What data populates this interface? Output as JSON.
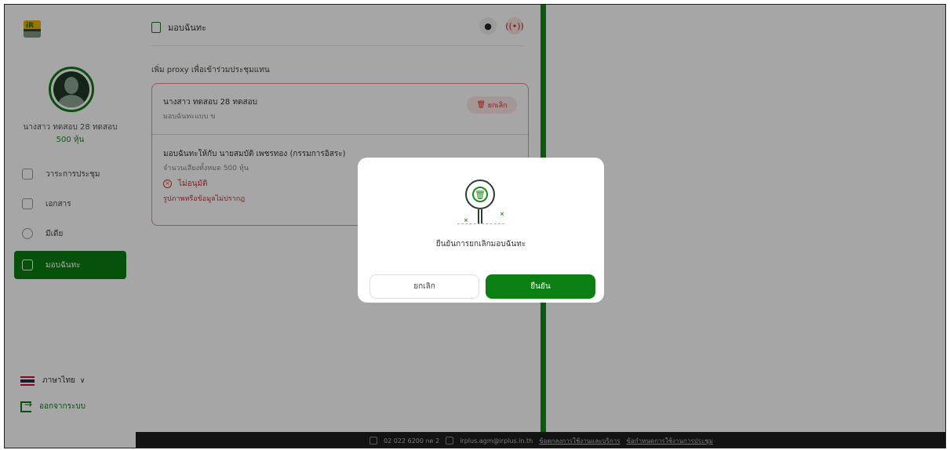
{
  "sidebar": {
    "user_name": "นางสาว ทดสอบ 28 ทดสอบ",
    "user_shares": "500 หุ้น",
    "nav": [
      {
        "label": "วาระการประชุม",
        "icon": "agenda-icon"
      },
      {
        "label": "เอกสาร",
        "icon": "folder-icon"
      },
      {
        "label": "มีเดีย",
        "icon": "play-icon"
      },
      {
        "label": "มอบฉันทะ",
        "icon": "proxy-doc-icon"
      }
    ],
    "language": "ภาษาไทย",
    "logout": "ออกจากระบบ"
  },
  "panel": {
    "title": "มอบฉันทะ",
    "proxy_add_text": "เพิ่ม proxy เพื่อเข้าร่วมประชุมแทน",
    "card": {
      "name": "นางสาว ทดสอบ 28 ทดสอบ",
      "type": "มอบฉันทะแบบ ข",
      "cancel_label": "ยกเลิก",
      "assigned_to": "มอบฉันทะให้กับ นายสมบัติ เพชรทอง (กรรมการอิสระ)",
      "votes": "จำนวนเสียงทั้งหมด 500 หุ้น",
      "status": "ไม่อนุมัติ",
      "note": "รูปภาพหรือข้อมูลไม่ปรากฎ"
    }
  },
  "footer": {
    "phone": "02 022 6200 กด 2",
    "email": "irplus.agm@irplus.in.th",
    "terms": "ข้อตกลงการใช้งานและบริการ",
    "rules": "ข้อกำหนดการใช้งานการประชุม"
  },
  "modal": {
    "message": "ยืนยันการยกเลิกมอบฉันทะ",
    "cancel": "ยกเลิก",
    "confirm": "ยืนยัน"
  },
  "colors": {
    "brand_green": "#0b7f12",
    "danger": "#d32f2f"
  }
}
